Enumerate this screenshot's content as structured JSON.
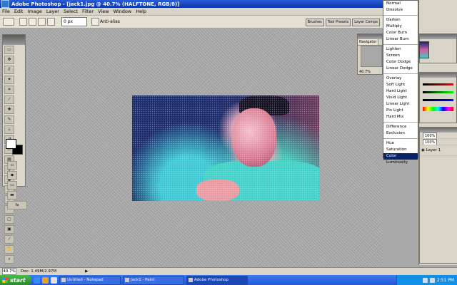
{
  "window": {
    "title": "Adobe Photoshop - [jack1.jpg @ 40.7% (HALFTONE, RGB/8)]"
  },
  "menubar": {
    "items": [
      "File",
      "Edit",
      "Image",
      "Layer",
      "Select",
      "Filter",
      "View",
      "Window",
      "Help"
    ]
  },
  "options": {
    "feather": "0 px",
    "anti_alias": "Anti-alias"
  },
  "palette_well": [
    "Brushes",
    "Tool Presets",
    "Layer Comps"
  ],
  "navigator": {
    "tab": "Navigator",
    "zoom": "40.7%"
  },
  "dropdown_menu": {
    "items": [
      "Normal",
      "Dissolve",
      "Darken",
      "Multiply",
      "Color Burn",
      "Linear Burn",
      "Lighten",
      "Screen",
      "Color Dodge",
      "Linear Dodge",
      "Overlay",
      "Soft Light",
      "Hard Light",
      "Vivid Light",
      "Linear Light",
      "Pin Light",
      "Hard Mix",
      "Difference",
      "Exclusion",
      "Hue",
      "Saturation",
      "Color",
      "Luminosity"
    ],
    "highlighted": "Color"
  },
  "layers": {
    "opacity": "100%",
    "fill": "100%",
    "layer_name": "Layer 1"
  },
  "statusbar": {
    "zoom": "40.7%",
    "doc": "Doc: 1.49M/2.97M"
  },
  "taskbar": {
    "start": "start",
    "tasks": [
      "Untitled - Notepad",
      "Jack1 - Paint",
      "Adobe Photoshop"
    ],
    "time": "2:51 PM"
  }
}
